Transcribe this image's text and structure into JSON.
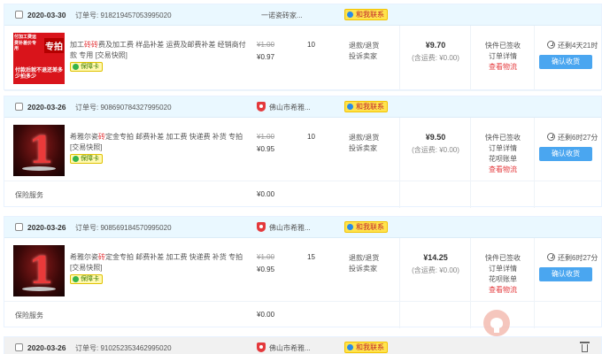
{
  "orders": [
    {
      "date": "2020-03-30",
      "order_no": "订单号: 918219457053995020",
      "shop": "一诺瓷砖家...",
      "contact": "和我联系",
      "thumb": {
        "line_a": "付加工费运费补差价专用",
        "line_b": "专拍",
        "line_c": "付款后就不退还差多少拍多少"
      },
      "title_pre": "加工",
      "title_hl": "砖砖",
      "title_post": "费及加工费 样品补差 运费及邮费补差 经销商付款 专用 [交易快照]",
      "guard": "保障卡",
      "orig_price": "¥1.00",
      "price": "¥0.97",
      "qty": "10",
      "after_sale": [
        "退款/退货",
        "投诉卖家"
      ],
      "total": "¥9.70",
      "shipping": "(含运费: ¥0.00)",
      "status": [
        "快件已签收",
        "订单详情"
      ],
      "logistics": "查看物流",
      "remain": "还剩4天21时",
      "confirm": "确认收货"
    },
    {
      "date": "2020-03-26",
      "order_no": "订单号: 908690784327995020",
      "shop": "佛山市希雅...",
      "contact": "和我联系",
      "thumb_char": "1",
      "title_pre": "希雅尔瓷",
      "title_hl": "砖",
      "title_post": "定金专拍 邮费补差 加工费 快递费 补货 专拍 [交易快照]",
      "guard": "保障卡",
      "orig_price": "¥1.00",
      "price": "¥0.95",
      "qty": "10",
      "after_sale": [
        "退款/退货",
        "投诉卖家"
      ],
      "service_label": "保险服务",
      "service_price": "¥0.00",
      "total": "¥9.50",
      "shipping": "(含运费: ¥0.00)",
      "status": [
        "快件已签收",
        "订单详情",
        "花呗账单"
      ],
      "logistics": "查看物流",
      "remain": "还剩6时27分",
      "confirm": "确认收货"
    },
    {
      "date": "2020-03-26",
      "order_no": "订单号: 908569184570995020",
      "shop": "佛山市希雅...",
      "contact": "和我联系",
      "thumb_char": "1",
      "title_pre": "希雅尔瓷",
      "title_hl": "砖",
      "title_post": "定金专拍 邮费补差 加工费 快递费 补货 专拍 [交易快照]",
      "guard": "保障卡",
      "orig_price": "¥1.00",
      "price": "¥0.95",
      "qty": "15",
      "after_sale": [
        "退款/退货",
        "投诉卖家"
      ],
      "service_label": "保险服务",
      "service_price": "¥0.00",
      "total": "¥14.25",
      "shipping": "(含运费: ¥0.00)",
      "status": [
        "快件已签收",
        "订单详情",
        "花呗账单"
      ],
      "logistics": "查看物流",
      "remain": "还剩6时27分",
      "confirm": "确认收货"
    },
    {
      "date": "2020-03-26",
      "order_no": "订单号: 910252353462995020",
      "shop": "佛山市希雅...",
      "contact": "和我联系"
    }
  ],
  "icons": {
    "shop": "shop-badge-icon",
    "contact": "wangwang-chat-icon",
    "clock": "clock-icon",
    "trash": "trash-icon",
    "github": "github-corner-icon"
  },
  "colors": {
    "header_bg": "#eaf8ff",
    "accent_red": "#e4393c",
    "button_blue": "#4aa6f0"
  }
}
